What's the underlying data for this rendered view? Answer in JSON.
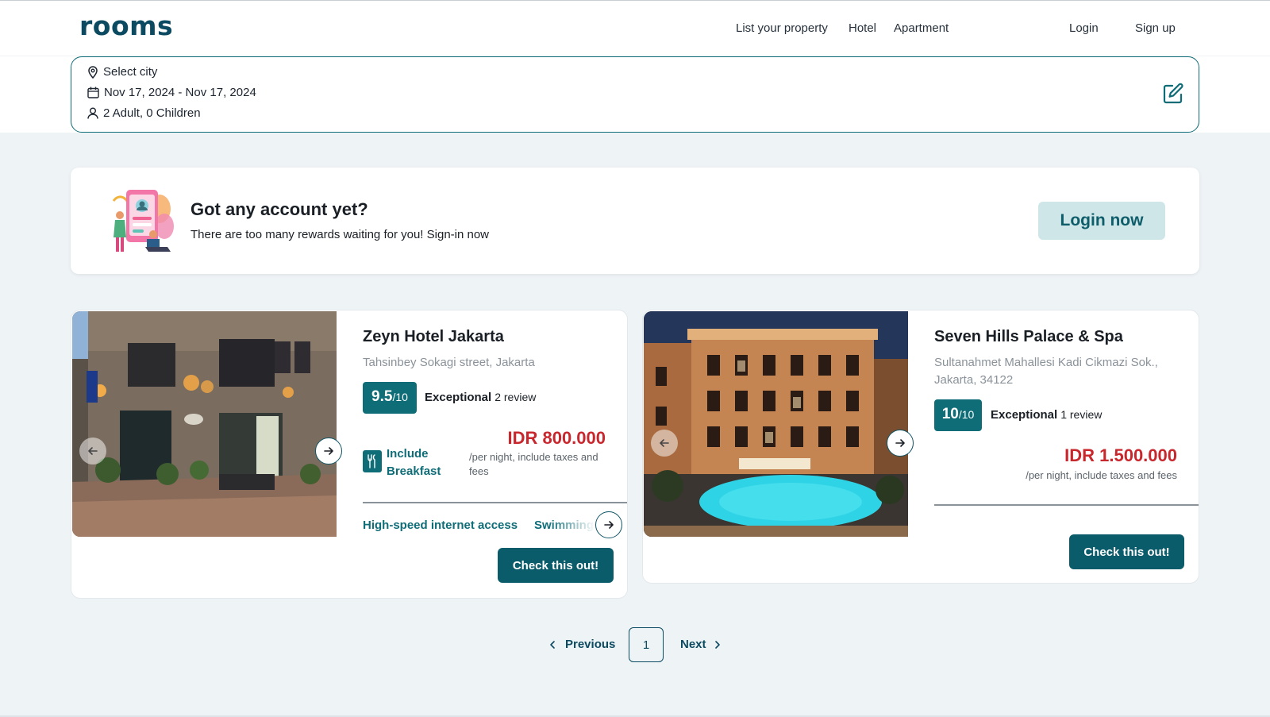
{
  "header": {
    "logo": "rooms",
    "nav": [
      "List your property",
      "Hotel",
      "Apartment"
    ],
    "login": "Login",
    "signup": "Sign up"
  },
  "search": {
    "city": "Select city",
    "dates": "Nov 17, 2024 - Nov 17, 2024",
    "guests": "2 Adult, 0 Children"
  },
  "banner": {
    "title": "Got any account yet?",
    "subtitle": "There are too many rewards waiting for you! Sign-in now",
    "button": "Login now"
  },
  "hotels": [
    {
      "name": "Zeyn Hotel Jakarta",
      "address": "Tahsinbey Sokagi street, Jakarta",
      "score": "9.5",
      "score_max": "/10",
      "rating_word": "Exceptional",
      "reviews": "2 review",
      "breakfast": "Include Breakfast",
      "price": "IDR 800.000",
      "price_note": "/per night, include taxes and fees",
      "amenities": [
        "High-speed internet access",
        "Swimming"
      ],
      "cta": "Check this out!"
    },
    {
      "name": "Seven Hills Palace & Spa",
      "address": "Sultanahmet Mahallesi Kadi Cikmazi Sok., Jakarta, 34122",
      "score": "10",
      "score_max": "/10",
      "rating_word": "Exceptional",
      "reviews": "1 review",
      "price": "IDR 1.500.000",
      "price_note": "/per night, include taxes and fees",
      "cta": "Check this out!"
    }
  ],
  "pagination": {
    "previous": "Previous",
    "page": "1",
    "next": "Next"
  },
  "colors": {
    "primary": "#0f6d78",
    "brand": "#0b4a60",
    "price": "#c8272d"
  }
}
